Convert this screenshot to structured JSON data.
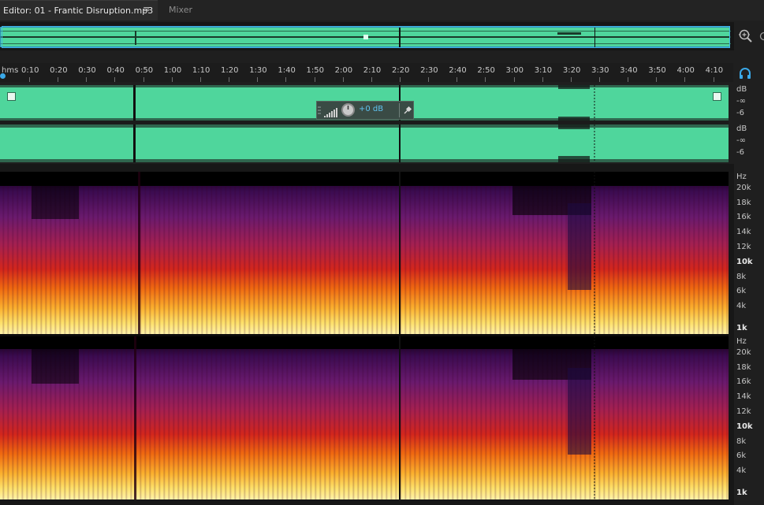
{
  "tabs": {
    "editor_label": "Editor: 01 - Frantic Disruption.mp3",
    "menu_icon": "≡",
    "mixer_label": "Mixer"
  },
  "ruler": {
    "unit": "hms",
    "ticks": [
      "0:10",
      "0:20",
      "0:30",
      "0:40",
      "0:50",
      "1:00",
      "1:10",
      "1:20",
      "1:30",
      "1:40",
      "1:50",
      "2:00",
      "2:10",
      "2:20",
      "2:30",
      "2:40",
      "2:50",
      "3:00",
      "3:10",
      "3:20",
      "3:30",
      "3:40",
      "3:50",
      "4:00",
      "4:10"
    ]
  },
  "waveform_scale": {
    "ch1": [
      "dB",
      "-∞",
      "-6"
    ],
    "ch2": [
      "dB",
      "-∞",
      "-6"
    ]
  },
  "gain_hud": {
    "value": "+0 dB"
  },
  "spectral_scale": {
    "unit": "Hz",
    "labels": [
      "20k",
      "18k",
      "16k",
      "14k",
      "12k",
      "10k",
      "8k",
      "6k",
      "4k",
      "1k"
    ]
  },
  "icons": {
    "zoom": "zoom-in-icon",
    "headphones": "headphones-icon",
    "pin": "pin-icon",
    "fade": "fade-handle-icon"
  },
  "colors": {
    "waveform": "#4fd69c",
    "accent": "#3aa8e8",
    "gain_value": "#5fc3f0"
  }
}
